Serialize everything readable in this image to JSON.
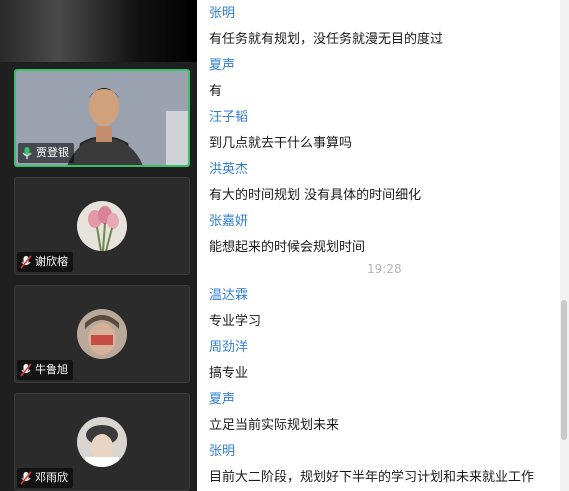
{
  "participants": [
    {
      "name": "贾登银",
      "mic": "on"
    },
    {
      "name": "谢欣榕",
      "mic": "muted"
    },
    {
      "name": "牛鲁旭",
      "mic": "muted"
    },
    {
      "name": "邓雨欣",
      "mic": "muted"
    }
  ],
  "chat": {
    "messages": [
      {
        "sender": "张明",
        "text": "有任务就有规划，没任务就漫无目的度过"
      },
      {
        "sender": "夏声",
        "text": "有"
      },
      {
        "sender": "汪子韬",
        "text": "到几点就去干什么事算吗"
      },
      {
        "sender": "洪英杰",
        "text": "有大的时间规划   没有具体的时间细化"
      },
      {
        "sender": "张嘉妍",
        "text": "能想起来的时候会规划时间"
      },
      {
        "sender": "温达霖",
        "text": "专业学习"
      },
      {
        "sender": "周劲洋",
        "text": "搞专业"
      },
      {
        "sender": "夏声",
        "text": "立足当前实际规划未来"
      },
      {
        "sender": "张明",
        "text": "目前大二阶段，规划好下半年的学习计划和未来就业工作"
      }
    ],
    "timestamp": "19:28"
  },
  "colors": {
    "sender": "#2f7fd6",
    "active_border": "#37c26a"
  }
}
